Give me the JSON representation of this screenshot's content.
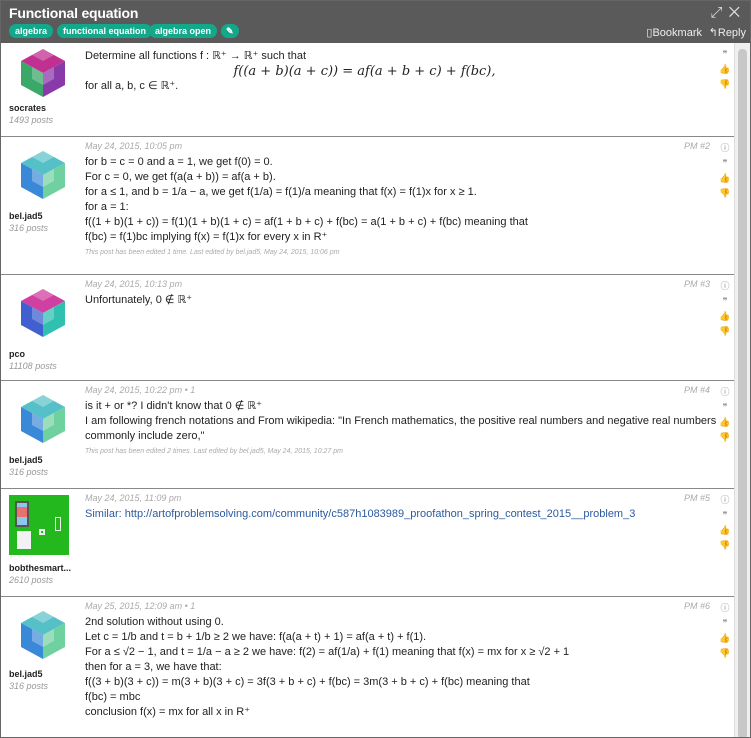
{
  "header": {
    "title": "Functional equation",
    "tags": [
      "algebra",
      "functional equation",
      "algebra open"
    ],
    "edit_icon": "pencil-icon",
    "bookmark": "Bookmark",
    "reply": "Reply"
  },
  "posts": [
    {
      "user": "socrates",
      "count": "1493 posts",
      "date": "",
      "pm": "",
      "lines": [
        "Determine all functions  f : ℝ⁺ → ℝ⁺ such that",
        "f((a + b)(a + c)) = af(a + b + c) + f(bc),",
        "for all a, b, c ∈ ℝ⁺."
      ],
      "edit": ""
    },
    {
      "user": "bel.jad5",
      "count": "316 posts",
      "date": "May 24, 2015, 10:05 pm",
      "pm": "PM #2",
      "lines": [
        "for b = c = 0 and a = 1, we get f(0) = 0.",
        "For c = 0, we get f(a(a + b)) = af(a + b).",
        "for a ≤ 1, and b = 1/a − a, we get f(1/a) = f(1)/a meaning that f(x) = f(1)x for x ≥ 1.",
        "for a = 1:",
        "f((1 + b)(1 + c)) = f(1)(1 + b)(1 + c) = af(1 + b + c) + f(bc) = a(1 + b + c) + f(bc) meaning that",
        "f(bc) = f(1)bc implying f(x) = f(1)x for every x in R⁺"
      ],
      "edit": "This post has been edited 1 time. Last edited by bel.jad5, May 24, 2015, 10:06 pm"
    },
    {
      "user": "pco",
      "count": "11108 posts",
      "date": "May 24, 2015, 10:13 pm",
      "pm": "PM #3",
      "lines": [
        "Unfortunately, 0 ∉ ℝ⁺"
      ],
      "edit": ""
    },
    {
      "user": "bel.jad5",
      "count": "316 posts",
      "date": "May 24, 2015, 10:22 pm • 1",
      "pm": "PM #4",
      "lines": [
        "is it + or *? I didn't know that 0 ∉ ℝ⁺",
        "I am following french notations and From wikipedia: \"In French mathematics, the positive real numbers and negative real numbers",
        "commonly include zero,\""
      ],
      "edit": "This post has been edited 2 times. Last edited by bel.jad5, May 24, 2015, 10:27 pm"
    },
    {
      "user": "bobthesmart...",
      "count": "2610 posts",
      "date": "May 24, 2015, 11:09 pm",
      "pm": "PM #5",
      "lines": [
        "Similar: http://artofproblemsolving.com/community/c587h1083989_proofathon_spring_contest_2015__problem_3"
      ],
      "edit": ""
    },
    {
      "user": "bel.jad5",
      "count": "316 posts",
      "date": "May 25, 2015, 12:09 am • 1",
      "pm": "PM #6",
      "lines": [
        "2nd solution without using 0.",
        "Let c = 1/b and t = b + 1/b ≥ 2 we have: f(a(a + t) + 1) = af(a + t) + f(1).",
        "For a ≤ √2 − 1, and t = 1/a − a ≥ 2 we have: f(2) = af(1/a) + f(1) meaning that f(x) = mx for x ≥ √2 + 1",
        "then for a = 3, we have that:",
        "f((3 + b)(3 + c)) = m(3 + b)(3 + c) = 3f(3 + b + c) + f(bc) = 3m(3 + b + c) + f(bc) meaning that",
        "f(bc) = mbc",
        "conclusion f(x) = mx for all x in R⁺"
      ],
      "edit": ""
    }
  ],
  "colors": {
    "header": "#5a5a5a",
    "tag": "#13a88a",
    "link": "#2c5aa0"
  }
}
